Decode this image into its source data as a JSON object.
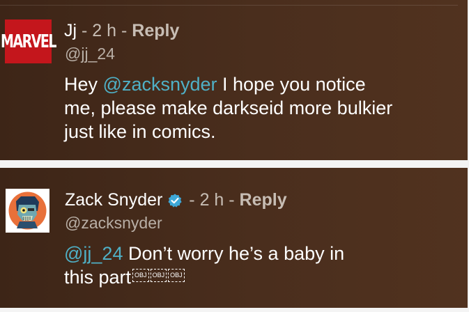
{
  "comment1": {
    "avatar_text": "MARVEL",
    "author": "Jj",
    "separator1": " - ",
    "time": "2 h",
    "separator2": " - ",
    "reply_label": "Reply",
    "handle": "@jj_24",
    "body_pre": "Hey ",
    "mention": "@zacksnyder",
    "body_line1_post": " I hope you notice",
    "body_line2": "me, please make darkseid more bulkier",
    "body_line3": "just like in comics."
  },
  "comment2": {
    "author": "Zack Snyder",
    "separator1": " - ",
    "time": "2 h",
    "separator2": " - ",
    "reply_label": "Reply",
    "handle": "@zacksnyder",
    "mention": "@jj_24",
    "body_line1_post": " Don’t worry he’s a baby in",
    "body_line2": "this part",
    "obj_placeholders": [
      "OBJ",
      "OBJ",
      "OBJ"
    ]
  },
  "colors": {
    "mention": "#4fb0c6",
    "verified": "#3ea8d8",
    "marvel_red": "#c4161c",
    "card_bg": "#4a2e1d"
  },
  "icons": {
    "verified": "verified-checkmark-icon"
  }
}
